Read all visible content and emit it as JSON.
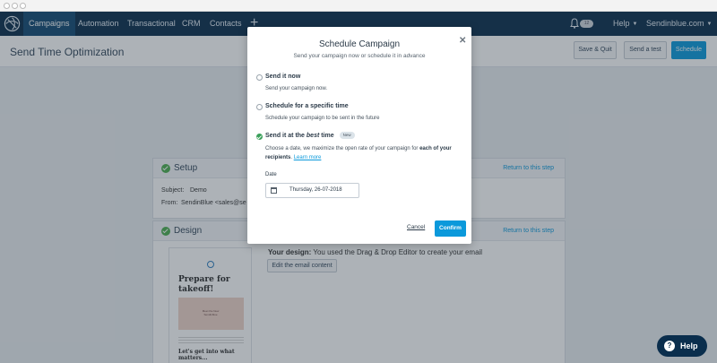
{
  "nav": {
    "items": [
      "Campaigns",
      "Automation",
      "Transactional",
      "CRM",
      "Contacts"
    ],
    "add_label": "+",
    "help_label": "Help",
    "account_label": "Sendinblue.com",
    "bell_count": "12",
    "brand_color": "#0a2e4d"
  },
  "header": {
    "title": "Send Time Optimization",
    "save_quit": "Save & Quit",
    "send_test": "Send a test",
    "schedule": "Schedule"
  },
  "setup": {
    "heading": "Setup",
    "link": "Return to this step",
    "subject_label": "Subject:",
    "subject_value": "Demo",
    "from_label": "From:",
    "from_value": "SendinBlue <sales@se"
  },
  "design": {
    "heading": "Design",
    "link": "Return to this step",
    "your_design_label": "Your design:",
    "your_design_text": "You used the Drag & Drop Editor to create your email",
    "edit_button": "Edit the email content",
    "thumb_title": "Prepare for takeoff!",
    "thumb_image_text": "Meet the New Sendinblue",
    "thumb_footer": "Let's get into what matters..."
  },
  "modal": {
    "title": "Schedule Campaign",
    "subtitle": "Send your campaign now or schedule it in advance",
    "close": "✕",
    "options": [
      {
        "label": "Send it now",
        "desc": "Send your campaign now."
      },
      {
        "label": "Schedule for a specific time",
        "desc": "Schedule your campaign to be sent in the future"
      },
      {
        "label_pre": "Send it at the ",
        "label_em": "best",
        "label_post": " time",
        "badge": "New"
      }
    ],
    "best_desc_1": "Choose a date, we maximize the open rate of your campaign for ",
    "best_desc_bold": "each of your recipients",
    "best_desc_2": ". ",
    "learn_more": "Learn more",
    "date_label": "Date",
    "date_value": "Thursday, 26-07-2018",
    "cancel": "Cancel",
    "confirm": "Confirm",
    "selected_color": "#3aa05a",
    "accent_color": "#0b99db"
  },
  "help": {
    "label": "Help",
    "icon": "?"
  }
}
